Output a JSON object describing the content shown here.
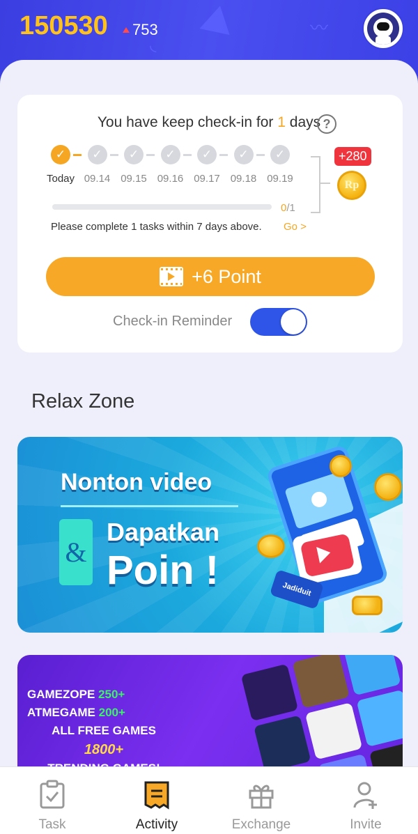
{
  "header": {
    "points": "150530",
    "points_delta": "753",
    "avatar_label": "astronaut avatar"
  },
  "checkin": {
    "title_prefix": "You have keep check-in for",
    "days_count": "1",
    "title_suffix": "days",
    "help_symbol": "?",
    "days": [
      {
        "label": "Today",
        "done": true
      },
      {
        "label": "09.14",
        "done": false
      },
      {
        "label": "09.15",
        "done": false
      },
      {
        "label": "09.16",
        "done": false
      },
      {
        "label": "09.17",
        "done": false
      },
      {
        "label": "09.18",
        "done": false
      },
      {
        "label": "09.19",
        "done": false
      }
    ],
    "reward_badge": "+280",
    "reward_coin": "Rp",
    "progress_current": "0",
    "progress_total": "/1",
    "progress_fraction": 0,
    "task_hint": "Please complete 1 tasks within 7 days above.",
    "go_link": "Go >",
    "point_button": "+6 Point",
    "reminder_label": "Check-in Reminder",
    "reminder_on": true
  },
  "relax_zone": {
    "title": "Relax Zone",
    "banner1": {
      "line1": "Nonton video",
      "amp": "&",
      "line2": "Dapatkan",
      "line3": "Poin !",
      "tag": "Jadiduit"
    },
    "banner2": {
      "row1_brand": "GAMEZOPE",
      "row1_count": "250+",
      "row2_brand": "ATMEGAME",
      "row2_count": "200+",
      "row3": "ALL FREE GAMES",
      "row4": "1800+",
      "row5": "TRENDING GAMES!"
    }
  },
  "bottom_nav": {
    "items": [
      {
        "label": "Task",
        "icon": "clipboard-check-icon",
        "active": false
      },
      {
        "label": "Activity",
        "icon": "receipt-icon",
        "active": true
      },
      {
        "label": "Exchange",
        "icon": "gift-icon",
        "active": false
      },
      {
        "label": "Invite",
        "icon": "add-user-icon",
        "active": false
      }
    ]
  },
  "colors": {
    "accent": "#f7a826",
    "header_blue": "#3b3ee0",
    "toggle_blue": "#2f55e8",
    "badge_red": "#f0343e"
  }
}
